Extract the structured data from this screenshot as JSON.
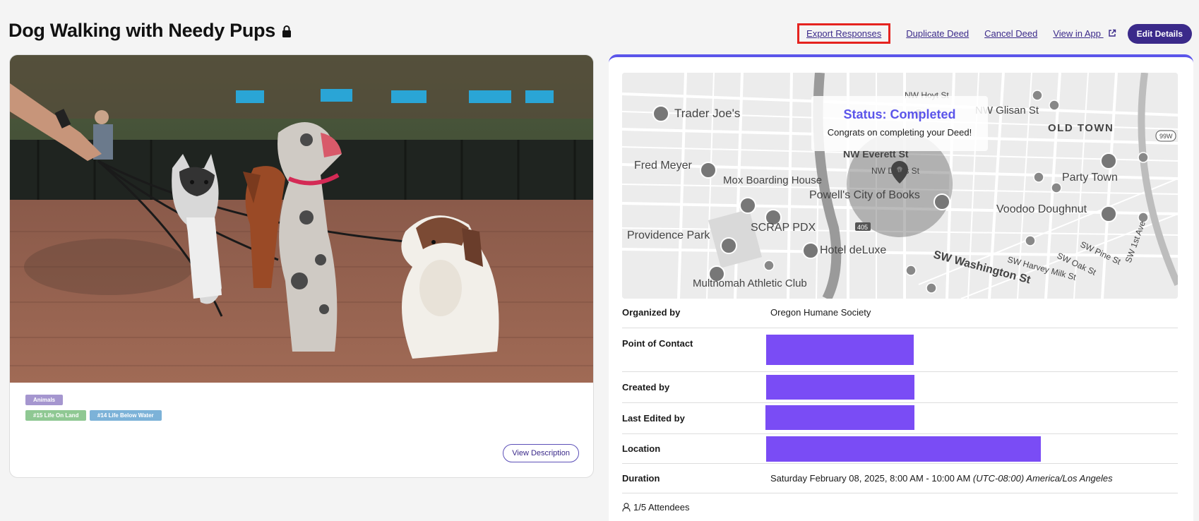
{
  "header": {
    "title": "Dog Walking with Needy Pups",
    "export_label": "Export Responses",
    "duplicate_label": "Duplicate Deed",
    "cancel_label": "Cancel Deed",
    "view_app_label": "View in App",
    "edit_label": "Edit Details"
  },
  "tags": {
    "category": "Animals",
    "sdg_land": "#15 Life On Land",
    "sdg_water": "#14 Life Below Water"
  },
  "left": {
    "view_description_label": "View Description"
  },
  "status": {
    "title": "Status: Completed",
    "message": "Congrats on completing your Deed!"
  },
  "map_labels": {
    "trader_joes": "Trader Joe's",
    "fred_meyer": "Fred Meyer",
    "mox": "Mox Boarding House",
    "powells": "Powell's City of Books",
    "providence": "Providence Park",
    "scrap": "SCRAP PDX",
    "hotel": "Hotel deLuxe",
    "athletic": "Multnomah Athletic Club",
    "old_town": "OLD TOWN",
    "party_town": "Party Town",
    "voodoo": "Voodoo Doughnut",
    "glisan": "NW Glisan St",
    "hoyt": "NW Hoyt St",
    "everett": "NW Everett St",
    "davis": "NW Davis St",
    "washington": "SW Washington St",
    "harvey": "SW Harvey Milk St",
    "oak": "SW Oak St",
    "pine": "SW Pine St",
    "first_ave": "SW 1st Ave",
    "hwy405": "405",
    "hwy99w": "99W"
  },
  "details": {
    "organized_by_label": "Organized by",
    "organized_by_value": "Oregon Humane Society",
    "contact_label": "Point of Contact",
    "created_by_label": "Created by",
    "last_edited_label": "Last Edited by",
    "location_label": "Location",
    "duration_label": "Duration",
    "duration_value": "Saturday February 08, 2025, 8:00 AM - 10:00 AM",
    "duration_tz": "(UTC-08:00) America/Los Angeles",
    "attendees": "1/5 Attendees"
  },
  "colors": {
    "accent": "#5b55ea",
    "brand_dark": "#3b2a8a",
    "redaction": "#7a4cf5",
    "highlight_box": "#e5231f"
  }
}
